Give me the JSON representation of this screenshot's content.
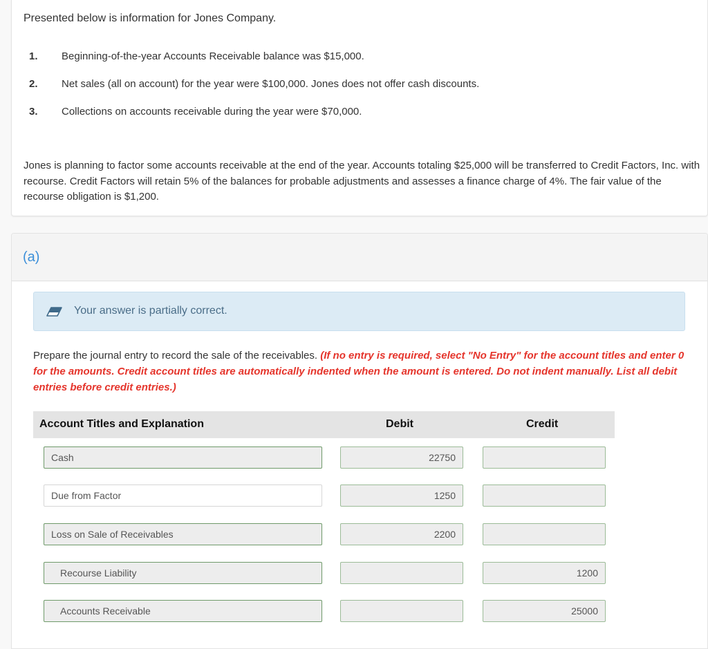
{
  "problem": {
    "intro": "Presented below is information for Jones Company.",
    "items": [
      {
        "num": "1.",
        "text": "Beginning-of-the-year Accounts Receivable balance was $15,000."
      },
      {
        "num": "2.",
        "text": "Net sales (all on account) for the year were $100,000. Jones does not offer cash discounts."
      },
      {
        "num": "3.",
        "text": "Collections on accounts receivable during the year were $70,000."
      }
    ],
    "paragraph": "Jones is planning to factor some accounts receivable at the end of the year. Accounts totaling $25,000 will be transferred to Credit Factors, Inc. with recourse. Credit Factors will retain 5% of the balances for probable adjustments and assesses a finance charge of 4%. The fair value of the recourse obligation is $1,200."
  },
  "part": {
    "label": "(a)",
    "feedback": {
      "icon": "eraser-icon",
      "text": "Your answer is partially correct."
    },
    "instructions": {
      "plain": "Prepare the journal entry to record the sale of the receivables. ",
      "highlight": "(If no entry is required, select \"No Entry\" for the account titles and enter 0 for the amounts. Credit account titles are automatically indented when the amount is entered. Do not indent manually. List all debit entries before credit entries.)"
    },
    "colors": {
      "accent": "#3b8fd9",
      "instruction_red": "#e5352c",
      "feedback_bg": "#dcebf5",
      "field_border": "#6f9a6a"
    },
    "table": {
      "headers": {
        "account": "Account Titles and Explanation",
        "debit": "Debit",
        "credit": "Credit"
      },
      "rows": [
        {
          "account": "Cash",
          "debit": "22750",
          "credit": ""
        },
        {
          "account": "Due from Factor",
          "debit": "1250",
          "credit": ""
        },
        {
          "account": "Loss on Sale of Receivables",
          "debit": "2200",
          "credit": ""
        },
        {
          "account": "Recourse Liability",
          "debit": "",
          "credit": "1200"
        },
        {
          "account": "Accounts Receivable",
          "debit": "",
          "credit": "25000"
        }
      ]
    }
  }
}
